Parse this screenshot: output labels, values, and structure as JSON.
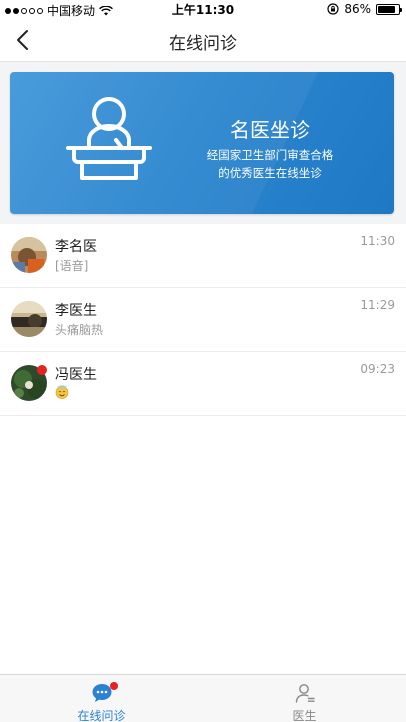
{
  "status_bar": {
    "carrier": "中国移动",
    "time": "上午11:30",
    "battery_percent": "86%",
    "battery_level": 0.86
  },
  "nav": {
    "title": "在线问诊"
  },
  "banner": {
    "title": "名医坐诊",
    "subtitle_line1": "经国家卫生部门审查合格",
    "subtitle_line2": "的优秀医生在线坐诊"
  },
  "conversations": [
    {
      "name": "李名医",
      "message": "[语音]",
      "time": "11:30",
      "unread": false
    },
    {
      "name": "李医生",
      "message": "头痛脑热",
      "time": "11:29",
      "unread": false
    },
    {
      "name": "冯医生",
      "message": "",
      "message_icon": "smiling-face-emoji",
      "time": "09:23",
      "unread": true
    }
  ],
  "tabs": [
    {
      "label": "在线问诊",
      "icon": "chat-bubble-icon",
      "active": true,
      "has_badge": true
    },
    {
      "label": "医生",
      "icon": "doctor-person-icon",
      "active": false,
      "has_badge": false
    }
  ],
  "colors": {
    "accent": "#2b82d4",
    "banner": "#2c86cf",
    "badge": "#e8231f"
  }
}
